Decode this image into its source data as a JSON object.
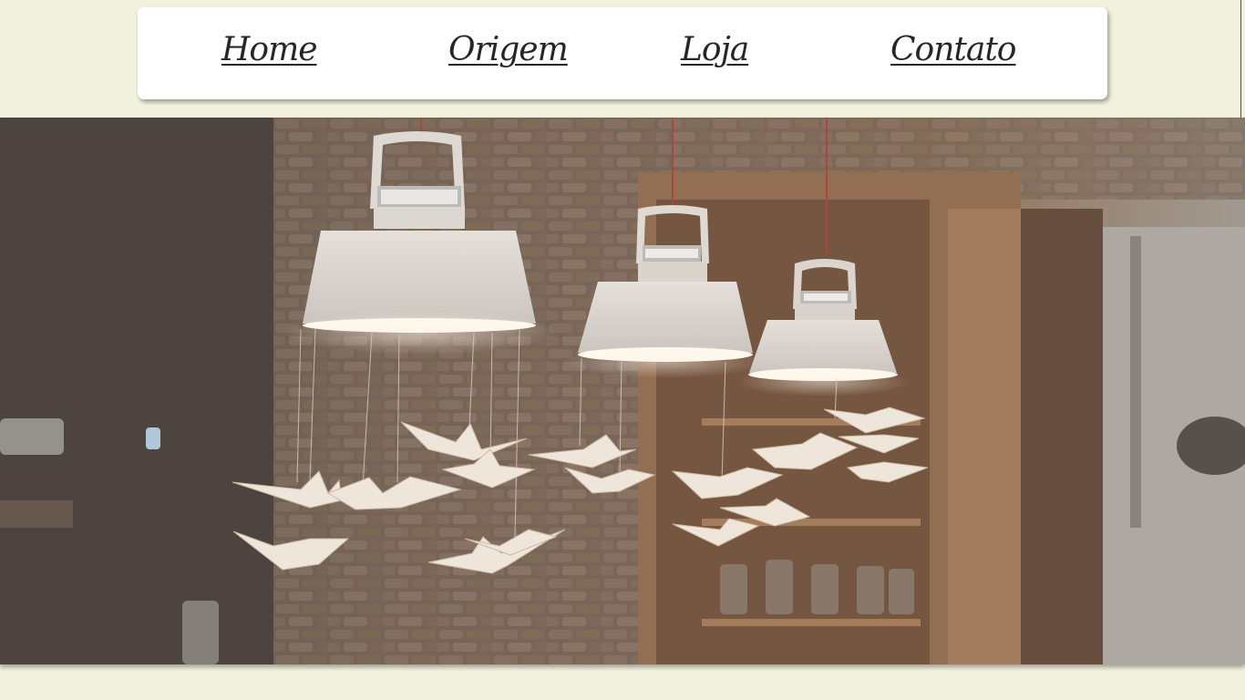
{
  "nav": {
    "items": [
      {
        "label": "Home"
      },
      {
        "label": "Origem"
      },
      {
        "label": "Loja"
      },
      {
        "label": "Contato"
      }
    ]
  },
  "hero": {
    "image": "pendant-lamps-with-origami-cranes-photo"
  },
  "colors": {
    "page_background": "#f2f1dd",
    "nav_background": "#ffffff",
    "nav_text": "#262626"
  }
}
